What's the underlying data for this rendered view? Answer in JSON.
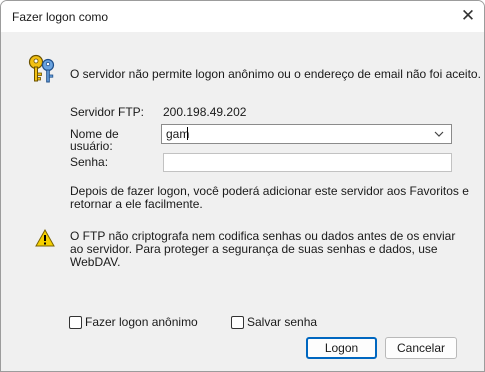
{
  "window": {
    "title": "Fazer logon como",
    "close_glyph": "✕"
  },
  "message": "O servidor não permite logon anônimo ou o endereço de email não foi aceito.",
  "form": {
    "server_label": "Servidor FTP:",
    "server_value": "200.198.49.202",
    "user_label": "Nome de usuário:",
    "user_value": "gam",
    "password_label": "Senha:",
    "password_value": ""
  },
  "info_text": "Depois de fazer logon, você poderá adicionar este servidor aos Favoritos e retornar a ele facilmente.",
  "warning_text": "O FTP não criptografa nem codifica senhas ou dados antes de os enviar ao servidor. Para proteger a segurança de suas senhas e dados, use WebDAV.",
  "options": {
    "anonymous_label": "Fazer logon anônimo",
    "anonymous_checked": false,
    "save_password_label": "Salvar senha",
    "save_password_checked": false
  },
  "buttons": {
    "logon": "Logon",
    "cancel": "Cancelar"
  },
  "icons": {
    "keys": "keys-icon",
    "warning": "warning-icon",
    "dropdown": "chevron-down-icon"
  },
  "colors": {
    "accent": "#0067c0",
    "dialog_bg": "#f0f0f0",
    "warning_yellow": "#f5d000"
  }
}
